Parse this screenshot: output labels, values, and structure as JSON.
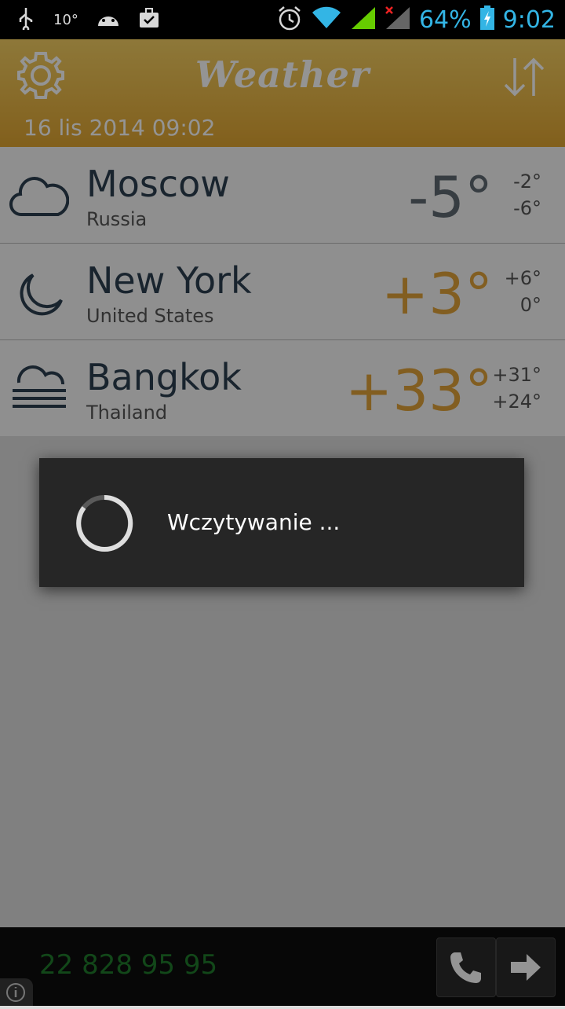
{
  "status_bar": {
    "notif_temp": "10°",
    "battery": "64%",
    "time": "9:02"
  },
  "header": {
    "title": "Weather",
    "date": "16 lis 2014 09:02"
  },
  "cities": [
    {
      "city": "Moscow",
      "country": "Russia",
      "temp": "-5°",
      "hi": "-2°",
      "lo": "-6°",
      "icon": "cloud-icon"
    },
    {
      "city": "New York",
      "country": "United States",
      "temp": "+3°",
      "hi": "+6°",
      "lo": "0°",
      "icon": "moon-icon"
    },
    {
      "city": "Bangkok",
      "country": "Thailand",
      "temp": "+33°",
      "hi": "+31°",
      "lo": "+24°",
      "icon": "fog-icon"
    }
  ],
  "loading_dialog": {
    "text": "Wczytywanie ..."
  },
  "bottom_bar": {
    "phone_number": "22 828 95 95"
  },
  "colors": {
    "header": "#e0a531",
    "temp_cold": "#5f6a72",
    "temp_warm": "#e1a33a",
    "text_dark": "#2c3e50"
  }
}
